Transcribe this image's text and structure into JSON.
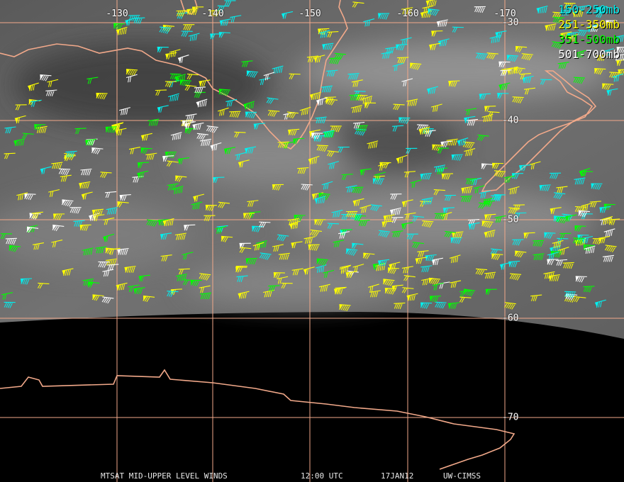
{
  "map": {
    "longitude_labels": [
      "-130",
      "-140",
      "-150",
      "-160",
      "-170"
    ],
    "latitude_labels": [
      "-30",
      "-40",
      "-50",
      "-60",
      "-70"
    ],
    "graticule_color": "#f2a98a",
    "coastline_color": "#f2a98a",
    "background_imagery": "water-vapor-grayscale",
    "no_data_region": "black"
  },
  "legend": {
    "items": [
      {
        "label": "150-250mb",
        "color": "#00f0f0"
      },
      {
        "label": "251-350mb",
        "color": "#ffff00"
      },
      {
        "label": "351-500mb",
        "color": "#00ff00"
      },
      {
        "label": "501-700mb",
        "color": "#ffffff"
      }
    ]
  },
  "footer": {
    "product": "MTSAT MID-UPPER LEVEL WINDS",
    "time": "12:00 UTC",
    "date": "17JAN12",
    "source": "UW-CIMSS"
  }
}
